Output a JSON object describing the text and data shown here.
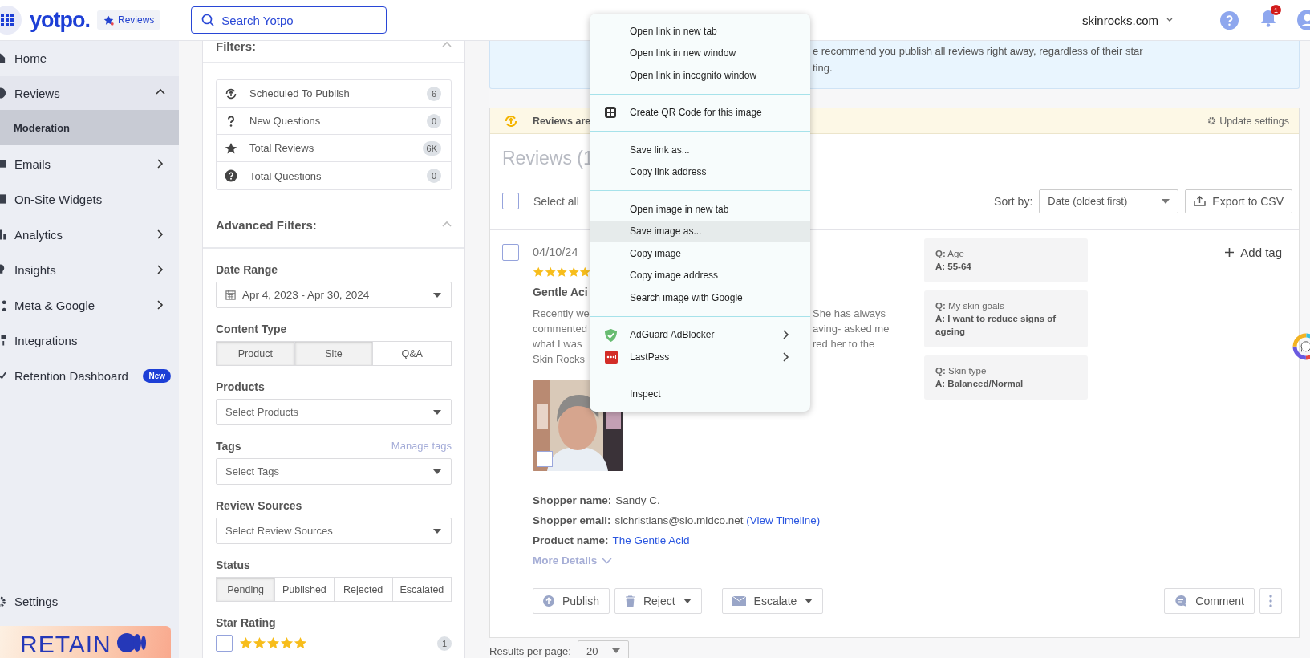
{
  "top_bar": {
    "brand": "yotpo.",
    "product_badge": "Reviews",
    "search": {
      "placeholder": "Search Yotpo"
    },
    "store": "skinrocks.com",
    "notification_count": "1"
  },
  "sidebar": {
    "items": [
      {
        "label": "Home",
        "kind": "link",
        "selected": false
      },
      {
        "label": "Reviews",
        "kind": "group",
        "expanded": true,
        "selected": false,
        "children": [
          {
            "label": "Moderation",
            "selected": true
          }
        ]
      },
      {
        "label": "Emails",
        "kind": "group",
        "expanded": false,
        "selected": false
      },
      {
        "label": "On-Site Widgets",
        "kind": "link",
        "selected": false
      },
      {
        "label": "Analytics",
        "kind": "group",
        "expanded": false,
        "selected": false
      },
      {
        "label": "Insights",
        "kind": "group",
        "expanded": false,
        "selected": false
      },
      {
        "label": "Meta & Google",
        "kind": "group",
        "expanded": false,
        "selected": false
      },
      {
        "label": "Integrations",
        "kind": "link",
        "selected": false
      },
      {
        "label": "Retention Dashboard",
        "kind": "link",
        "selected": false,
        "badge": "New"
      }
    ],
    "settings": "Settings",
    "promo": "RETAIN"
  },
  "filters": {
    "title": "Filters:",
    "quick_filters": [
      {
        "label": "Scheduled To Publish",
        "count": "6"
      },
      {
        "label": "New Questions",
        "count": "0"
      },
      {
        "label": "Total Reviews",
        "count": "6K"
      },
      {
        "label": "Total Questions",
        "count": "0"
      }
    ],
    "advanced_title": "Advanced Filters:",
    "date_range": {
      "label": "Date Range",
      "value": "Apr 4, 2023 - Apr 30, 2024"
    },
    "content_type": {
      "label": "Content Type",
      "options": [
        {
          "label": "Product",
          "selected": true
        },
        {
          "label": "Site",
          "selected": true
        },
        {
          "label": "Q&A",
          "selected": false
        }
      ]
    },
    "products": {
      "label": "Products",
      "placeholder": "Select Products"
    },
    "tags": {
      "label": "Tags",
      "link": "Manage tags",
      "placeholder": "Select Tags"
    },
    "review_sources": {
      "label": "Review Sources",
      "placeholder": "Select Review Sources"
    },
    "status": {
      "label": "Status",
      "options": [
        {
          "label": "Pending",
          "selected": true
        },
        {
          "label": "Published",
          "selected": false
        },
        {
          "label": "Rejected",
          "selected": false
        },
        {
          "label": "Escalated",
          "selected": false
        }
      ]
    },
    "star_rating": {
      "label": "Star Rating",
      "rows": [
        {
          "checked": false,
          "stars": 5,
          "count": "1"
        }
      ]
    }
  },
  "main": {
    "banner": {
      "lines": [
        "e recommend you publish all reviews right away, regardless of their star",
        "ting."
      ]
    },
    "notice": {
      "text": "Reviews are",
      "action": "Update settings"
    },
    "title": "Reviews (1",
    "select_all": {
      "label": "Select all",
      "checked": false
    },
    "sort": {
      "label": "Sort by:",
      "value": "Date (oldest first)"
    },
    "export": "Export to CSV",
    "review": {
      "checked": false,
      "date": "04/10/24",
      "add_tag": "Add tag",
      "stars": 5,
      "title": "Gentle Aci",
      "text_left": [
        "Recently we",
        "commented",
        "what I was",
        "Skin Rocks"
      ],
      "text_right": [
        "She has always",
        "aving- asked me",
        "red her to the"
      ],
      "photo": {
        "kind": "picture",
        "checked": false
      },
      "details": [
        {
          "label": "Shopper name:",
          "value": "Sandy C."
        },
        {
          "label": "Shopper email:",
          "value": "slchristians@sio.midco.net",
          "link": "(View Timeline)"
        },
        {
          "label": "Product name:",
          "link": "The Gentle Acid"
        }
      ],
      "more": "More Details",
      "answers": [
        {
          "question": "**Q:** Age",
          "answer": "A: 55-64"
        },
        {
          "question": "**Q:** My skin goals",
          "answer": "A: I want to reduce signs of ageing"
        },
        {
          "question": "**Q:** Skin type",
          "answer": "A: Balanced/Normal"
        }
      ],
      "actions": [
        {
          "label": "Publish",
          "dropdown": false
        },
        {
          "label": "Reject",
          "dropdown": true
        },
        {
          "label": "Escalate",
          "dropdown": true
        }
      ],
      "comment": "Comment"
    },
    "results_per_page": {
      "label": "Results per page:",
      "value": "20"
    }
  },
  "context_menu": {
    "groups": [
      [
        {
          "label": "Open link in new tab",
          "kind": "plain",
          "highlighted": false,
          "submenu": false
        },
        {
          "label": "Open link in new window",
          "kind": "plain",
          "highlighted": false,
          "submenu": false
        },
        {
          "label": "Open link in incognito window",
          "kind": "plain",
          "highlighted": false,
          "submenu": false
        }
      ],
      [
        {
          "label": "Create QR Code for this image",
          "kind": "qr",
          "highlighted": false,
          "submenu": false
        }
      ],
      [
        {
          "label": "Save link as...",
          "kind": "plain",
          "highlighted": false,
          "submenu": false
        },
        {
          "label": "Copy link address",
          "kind": "plain",
          "highlighted": false,
          "submenu": false
        }
      ],
      [
        {
          "label": "Open image in new tab",
          "kind": "plain",
          "highlighted": false,
          "submenu": false
        },
        {
          "label": "Save image as...",
          "kind": "plain",
          "highlighted": true,
          "submenu": false
        },
        {
          "label": "Copy image",
          "kind": "plain",
          "highlighted": false,
          "submenu": false
        },
        {
          "label": "Copy image address",
          "kind": "plain",
          "highlighted": false,
          "submenu": false
        },
        {
          "label": "Search image with Google",
          "kind": "plain",
          "highlighted": false,
          "submenu": false
        }
      ],
      [
        {
          "label": "AdGuard AdBlocker",
          "kind": "shield",
          "highlighted": false,
          "submenu": true
        },
        {
          "label": "LastPass",
          "kind": "password",
          "highlighted": false,
          "submenu": true
        }
      ],
      [
        {
          "label": "Inspect",
          "kind": "plain",
          "highlighted": false,
          "submenu": false
        }
      ]
    ]
  }
}
